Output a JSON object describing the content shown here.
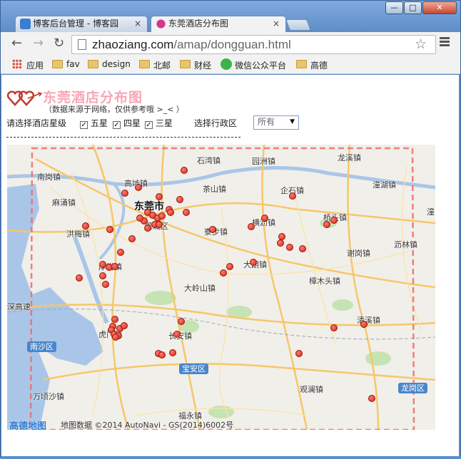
{
  "window": {
    "minimize": "—",
    "maximize": "□",
    "close": "✕"
  },
  "tabs": [
    {
      "title": "博客后台管理 - 博客园",
      "close": "×"
    },
    {
      "title": "东莞酒店分布图",
      "close": "×"
    }
  ],
  "address": {
    "host": "zhaoziang.com",
    "path": "/amap/dongguan.html"
  },
  "bookmarks": [
    {
      "label": "应用",
      "icon": "apps-icon"
    },
    {
      "label": "fav",
      "icon": "folder-icon"
    },
    {
      "label": "design",
      "icon": "folder-icon"
    },
    {
      "label": "北邮",
      "icon": "folder-icon"
    },
    {
      "label": "财经",
      "icon": "folder-icon"
    },
    {
      "label": "微信公众平台",
      "icon": "wechat-icon"
    },
    {
      "label": "高德",
      "icon": "folder-icon"
    }
  ],
  "page": {
    "title": "东莞酒店分布图",
    "subtitle": "（数据来源于网络，仅供参考哦 >_< ）",
    "star_label": "请选择酒店星级",
    "stars": [
      {
        "label": "五星",
        "checked": true
      },
      {
        "label": "四星",
        "checked": true
      },
      {
        "label": "三星",
        "checked": true
      }
    ],
    "district_label": "选择行政区",
    "district_value": "所有"
  },
  "map": {
    "places": [
      "石湾镇",
      "园洲镇",
      "龙溪镇",
      "南岗镇",
      "高埗镇",
      "茶山镇",
      "企石镇",
      "潼湖镇",
      "麻涌镇",
      "东莞市",
      "洪梅镇",
      "莞城区",
      "寮步镇",
      "横沥镇",
      "桥头镇",
      "谢岗镇",
      "沥林镇",
      "厚街镇",
      "大朗镇",
      "樟木头镇",
      "大岭山镇",
      "深高速",
      "清溪镇",
      "虎门镇",
      "长安镇",
      "万顷沙镇",
      "观澜镇",
      "福永镇",
      "潼"
    ],
    "districts": [
      "南沙区",
      "宝安区",
      "龙岗区"
    ],
    "logo": "高德地图",
    "copyright": "地图数据 ©2014 AutoNavi - GS(2014)6002号",
    "hotel_count": 58
  },
  "colors": {
    "title_pink": "#f7a6b8",
    "marker_red": "#d1261b",
    "water": "#a9c6e8",
    "boundary": "#f06a6a"
  }
}
